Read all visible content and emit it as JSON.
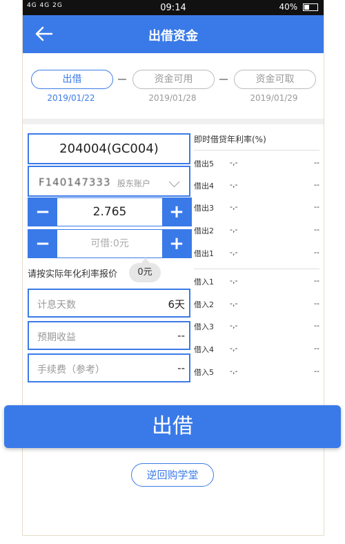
{
  "status_bar": {
    "network": "4G 4G  2G",
    "time": "09:14",
    "battery": "40%"
  },
  "header": {
    "title": "出借资金"
  },
  "steps": [
    {
      "label": "出借",
      "date": "2019/01/22"
    },
    {
      "label": "资金可用",
      "date": "2019/01/28"
    },
    {
      "label": "资金可取",
      "date": "2019/01/29"
    }
  ],
  "form": {
    "code": "204004(GC004)",
    "account": "F140147333",
    "account_label": "股东账户",
    "rate_value": "2.765",
    "amount_placeholder": "可借:0元",
    "hint": "请按实际年化利率报价",
    "bubble": "0元",
    "days_label": "计息天数",
    "days_value": "6天",
    "income_label": "预期收益",
    "income_value": "--",
    "fee_label": "手续费（参考）",
    "fee_value": "--"
  },
  "rates": {
    "title": "即时借贷年利率(%)",
    "lend": [
      {
        "name": "借出5",
        "rate": "-,-",
        "amount": "--"
      },
      {
        "name": "借出4",
        "rate": "-,-",
        "amount": "--"
      },
      {
        "name": "借出3",
        "rate": "-,-",
        "amount": "--"
      },
      {
        "name": "借出2",
        "rate": "-,-",
        "amount": "--"
      },
      {
        "name": "借出1",
        "rate": "-,-",
        "amount": "--"
      }
    ],
    "borrow": [
      {
        "name": "借入1",
        "rate": "-,-",
        "amount": "--"
      },
      {
        "name": "借入2",
        "rate": "-,-",
        "amount": "--"
      },
      {
        "name": "借入3",
        "rate": "-,-",
        "amount": "--"
      },
      {
        "name": "借入4",
        "rate": "-,-",
        "amount": "--"
      },
      {
        "name": "借入5",
        "rate": "-,-",
        "amount": "--"
      }
    ]
  },
  "actions": {
    "lend_button": "出借",
    "learn_button": "逆回购学堂"
  },
  "colors": {
    "accent": "#3a7ae8"
  }
}
